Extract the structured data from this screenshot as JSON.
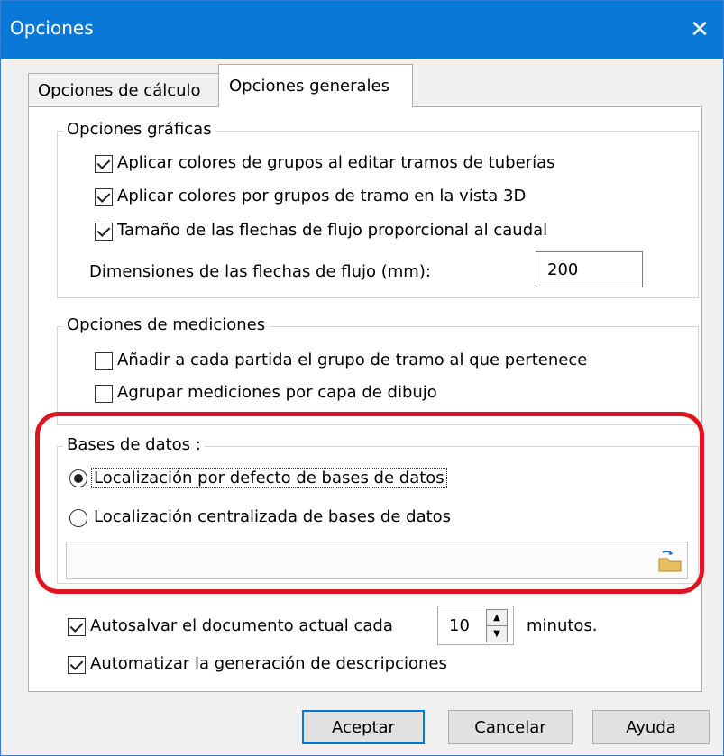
{
  "window": {
    "title": "Opciones"
  },
  "tabs": [
    {
      "label": "Opciones de cálculo",
      "active": false
    },
    {
      "label": "Opciones generales",
      "active": true
    }
  ],
  "graficas": {
    "legend": "Opciones gráficas",
    "options": [
      {
        "label": "Aplicar colores de grupos al editar tramos de tuberías",
        "checked": true
      },
      {
        "label": "Aplicar colores por grupos de tramo en la vista 3D",
        "checked": true
      },
      {
        "label": "Tamaño de las flechas de flujo proporcional al caudal",
        "checked": true
      }
    ],
    "dim_label": "Dimensiones de las flechas de flujo (mm):",
    "dim_value": "200"
  },
  "mediciones": {
    "legend": "Opciones de mediciones",
    "options": [
      {
        "label": "Añadir a cada partida el grupo de tramo al que pertenece",
        "checked": false
      },
      {
        "label": "Agrupar mediciones por capa de dibujo",
        "checked": false
      }
    ]
  },
  "bases": {
    "legend": "Bases de datos :",
    "options": [
      {
        "label": "Localización por defecto de bases de datos",
        "selected": true
      },
      {
        "label": "Localización centralizada de bases de datos",
        "selected": false
      }
    ],
    "path_value": ""
  },
  "autosave": {
    "label": "Autosalvar el documento actual cada",
    "value": "10",
    "unit": "minutos.",
    "checked": true
  },
  "autodesc": {
    "label": "Automatizar la generación de descripciones",
    "checked": true
  },
  "buttons": {
    "ok": "Aceptar",
    "cancel": "Cancelar",
    "help": "Ayuda"
  },
  "colors": {
    "titlebar": "#0a78d7",
    "highlight": "#e0141e",
    "default_button_border": "#0078d7"
  },
  "icons": [
    "close-icon",
    "folder-browse-icon",
    "spin-up-icon",
    "spin-down-icon"
  ]
}
